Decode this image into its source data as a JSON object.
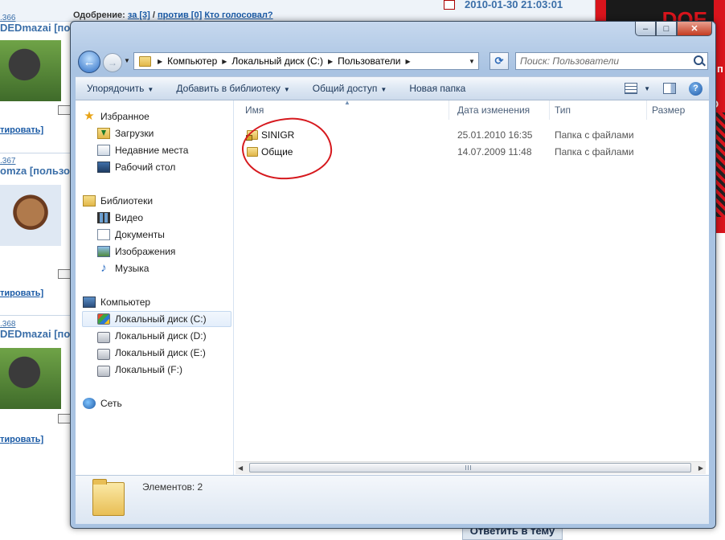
{
  "background": {
    "vote_label": "Одобрение:",
    "vote_for": "за [3]",
    "vote_sep": "/",
    "vote_against": "против [0]",
    "vote_who": "Кто голосовал?",
    "post_date": "2010-01-30 21:03:01",
    "posts": [
      {
        "id": ".366",
        "user": "DEDmazai [поль",
        "link": "тировать]"
      },
      {
        "id": ".367",
        "user": "omza [пользов",
        "link": "тировать]"
      },
      {
        "id": ".368",
        "user": "DEDmazai [пол",
        "link": "тировать]"
      }
    ],
    "right_logo": "DOE",
    "right_lines": [
      ": п",
      "е",
      "О"
    ],
    "reply_button": "Ответить в тему"
  },
  "window": {
    "caption_buttons": {
      "minimize": "–",
      "maximize": "□",
      "close": "✕"
    },
    "breadcrumb": [
      "Компьютер",
      "Локальный диск (C:)",
      "Пользователи"
    ],
    "search_placeholder": "Поиск: Пользователи",
    "toolbar": {
      "organize": "Упорядочить",
      "add_to_library": "Добавить в библиотеку",
      "share": "Общий доступ",
      "new_folder": "Новая папка"
    },
    "nav": {
      "favorites": "Избранное",
      "downloads": "Загрузки",
      "recent": "Недавние места",
      "desktop": "Рабочий стол",
      "libraries": "Библиотеки",
      "video": "Видео",
      "documents": "Документы",
      "images": "Изображения",
      "music": "Музыка",
      "computer": "Компьютер",
      "drive_c": "Локальный диск (C:)",
      "drive_d": "Локальный диск (D:)",
      "drive_e": "Локальный диск (E:)",
      "drive_f": "Локальный (F:)",
      "network": "Сеть"
    },
    "columns": {
      "name": "Имя",
      "modified": "Дата изменения",
      "type": "Тип",
      "size": "Размер"
    },
    "files": [
      {
        "name": "SINIGR",
        "modified": "25.01.2010 16:35",
        "type": "Папка с файлами"
      },
      {
        "name": "Общие",
        "modified": "14.07.2009 11:48",
        "type": "Папка с файлами"
      }
    ],
    "status": "Элементов: 2",
    "accent_annotation_color": "#d6191e"
  }
}
